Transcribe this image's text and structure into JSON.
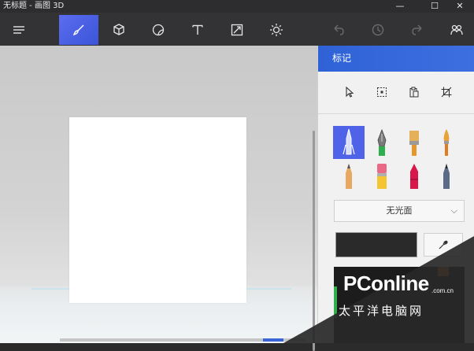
{
  "window": {
    "title": "无标题 - 画图 3D",
    "minimize": "—",
    "maximize": "☐",
    "close": "✕"
  },
  "toolbar": {
    "items": [
      {
        "name": "menu-icon",
        "active": false
      },
      {
        "name": "brushes-icon",
        "active": true
      },
      {
        "name": "3d-shapes-icon",
        "active": false
      },
      {
        "name": "stickers-icon",
        "active": false
      },
      {
        "name": "text-icon",
        "active": false
      },
      {
        "name": "canvas-icon",
        "active": false
      },
      {
        "name": "effects-icon",
        "active": false
      },
      {
        "name": "undo-icon",
        "active": false
      },
      {
        "name": "history-icon",
        "active": false
      },
      {
        "name": "redo-icon",
        "active": false
      },
      {
        "name": "community-icon",
        "active": false
      }
    ]
  },
  "panel": {
    "title": "标记",
    "select_tools": [
      "pointer-icon",
      "select-icon",
      "paste-icon",
      "crop-icon"
    ],
    "brushes": [
      {
        "name": "marker",
        "active": true
      },
      {
        "name": "calligraphy-pen",
        "active": false
      },
      {
        "name": "oil-brush",
        "active": false
      },
      {
        "name": "watercolor",
        "active": false
      },
      {
        "name": "pencil",
        "active": false
      },
      {
        "name": "eraser",
        "active": false
      },
      {
        "name": "crayon",
        "active": false
      },
      {
        "name": "pixel-pen",
        "active": false
      }
    ],
    "finish_value": "无光面",
    "current_color": "#2a2a2a"
  },
  "watermark": {
    "brand": "PConline",
    "domain": ".com.cn",
    "cn": "太平洋电脑网"
  },
  "colors": {
    "accent": "#3b55d8",
    "toolbar_bg": "#333336",
    "panel_header": "#2f62d6"
  }
}
